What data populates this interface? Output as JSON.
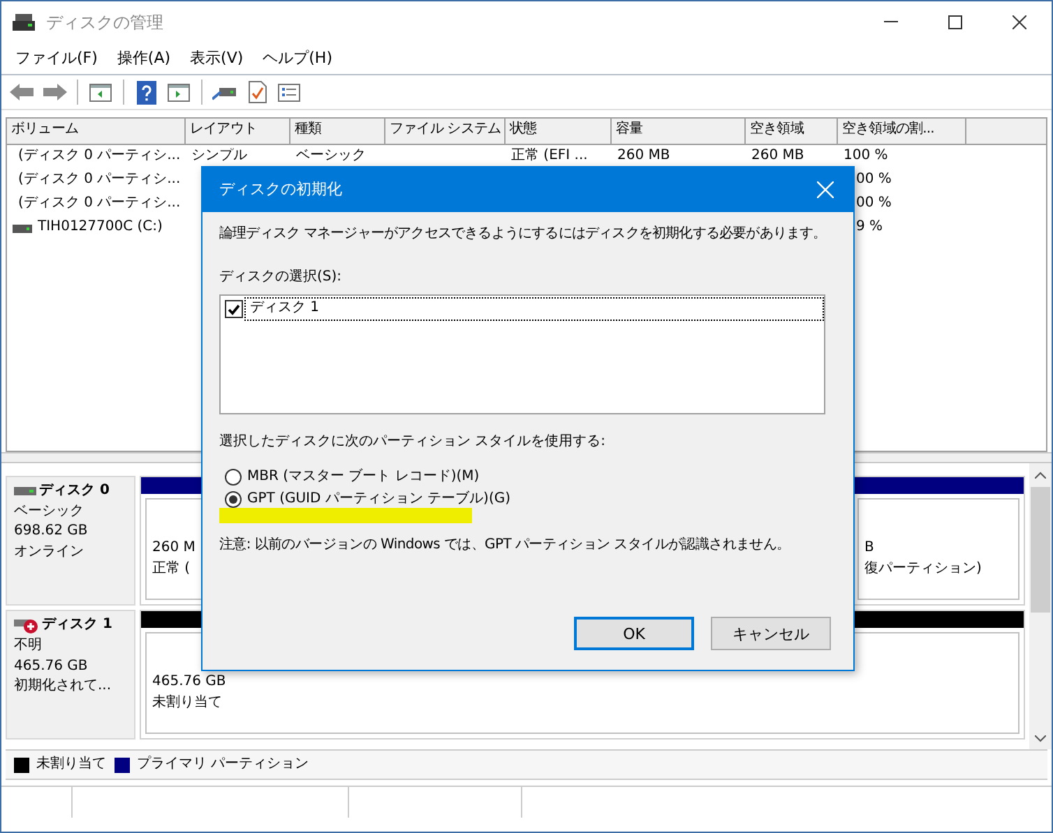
{
  "window": {
    "title": "ディスクの管理"
  },
  "menu": [
    "ファイル(F)",
    "操作(A)",
    "表示(V)",
    "ヘルプ(H)"
  ],
  "volume_table": {
    "columns": [
      "ボリューム",
      "レイアウト",
      "種類",
      "ファイル システム",
      "状態",
      "容量",
      "空き領域",
      "空き領域の割..."
    ],
    "rows": [
      {
        "covered": false,
        "volume": "(ディスク 0 パーティシ...",
        "layout": "シンプル",
        "type": "ベーシック",
        "status": "正常 (EFI ...",
        "capacity": "260 MB",
        "free_space": "260 MB",
        "free_percent": "100 %"
      },
      {
        "covered": true,
        "volume": "(ディスク 0 パーティシ...",
        "free_percent": "00 %"
      },
      {
        "covered": true,
        "volume": "(ディスク 0 パーティシ...",
        "free_percent": "00 %"
      },
      {
        "covered": true,
        "volume": "TIH0127700C (C:)",
        "free_percent": "9 %"
      }
    ]
  },
  "disks": [
    {
      "name": "ディスク 0",
      "error": false,
      "type": "ベーシック",
      "size": "698.62 GB",
      "status": "オンライン",
      "partitions": [
        {
          "kind": "primary",
          "lines": [
            "260 M",
            "正常 ("
          ]
        },
        {
          "kind": "primary",
          "lines": [
            "B",
            "復パーティション)"
          ]
        }
      ]
    },
    {
      "name": "ディスク 1",
      "error": true,
      "type": "不明",
      "size": "465.76 GB",
      "status": "初期化されて...",
      "partitions": [
        {
          "kind": "unallocated",
          "lines": [
            "465.76 GB",
            "未割り当て"
          ]
        }
      ]
    }
  ],
  "legend": [
    {
      "label": "未割り当て",
      "color": "#000000"
    },
    {
      "label": "プライマリ パーティション",
      "color": "#000080"
    }
  ],
  "dialog": {
    "title": "ディスクの初期化",
    "message": "論理ディスク マネージャーがアクセスできるようにするにはディスクを初期化する必要があります。",
    "disk_list_label": "ディスクの選択(S):",
    "disks": [
      {
        "label": "ディスク 1",
        "checked": true,
        "selected": true
      }
    ],
    "style_label": "選択したディスクに次のパーティション スタイルを使用する:",
    "styles": [
      {
        "label": "MBR (マスター ブート レコード)(M)",
        "selected": false,
        "highlighted": false
      },
      {
        "label": "GPT (GUID パーティション テーブル)(G)",
        "selected": true,
        "highlighted": true
      }
    ],
    "note": "注意: 以前のバージョンの Windows では、GPT パーティション スタイルが認識されません。",
    "buttons": [
      {
        "label": "OK",
        "default": true
      },
      {
        "label": "キャンセル",
        "default": false
      }
    ]
  }
}
